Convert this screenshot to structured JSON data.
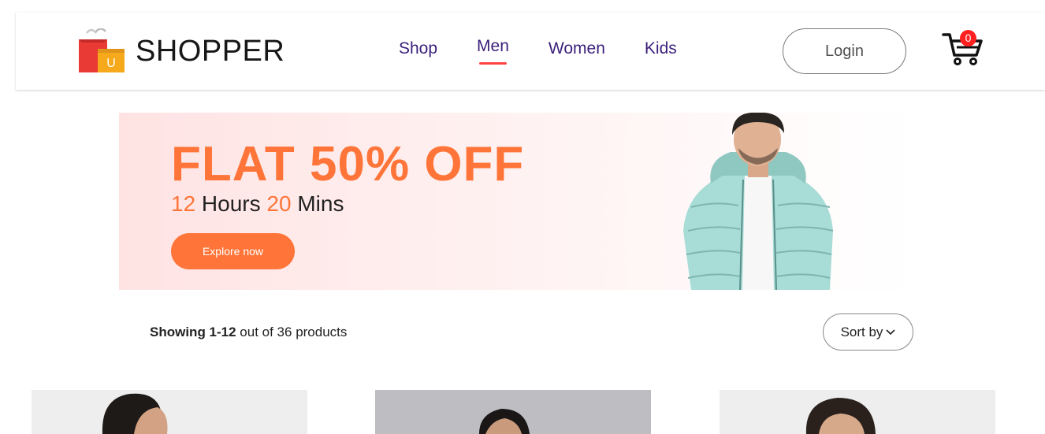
{
  "brand": {
    "name": "SHOPPER",
    "logo_letter": "U"
  },
  "nav": {
    "items": [
      {
        "label": "Shop"
      },
      {
        "label": "Men"
      },
      {
        "label": "Women"
      },
      {
        "label": "Kids"
      }
    ],
    "active": "Men"
  },
  "header": {
    "login_label": "Login",
    "cart_count": "0"
  },
  "banner": {
    "title": "FLAT 50% OFF",
    "hours": "12",
    "hours_label": " Hours ",
    "mins": "20",
    "mins_label": " Mins",
    "button_label": "Explore now"
  },
  "index": {
    "showing": "Showing 1-12",
    "rest": " out of 36 products"
  },
  "sort": {
    "label": "Sort by"
  },
  "colors": {
    "accent": "#ff7539",
    "nav_text": "#3b1f7a",
    "underline": "#ff4141",
    "cart_badge": "#ff2020"
  }
}
